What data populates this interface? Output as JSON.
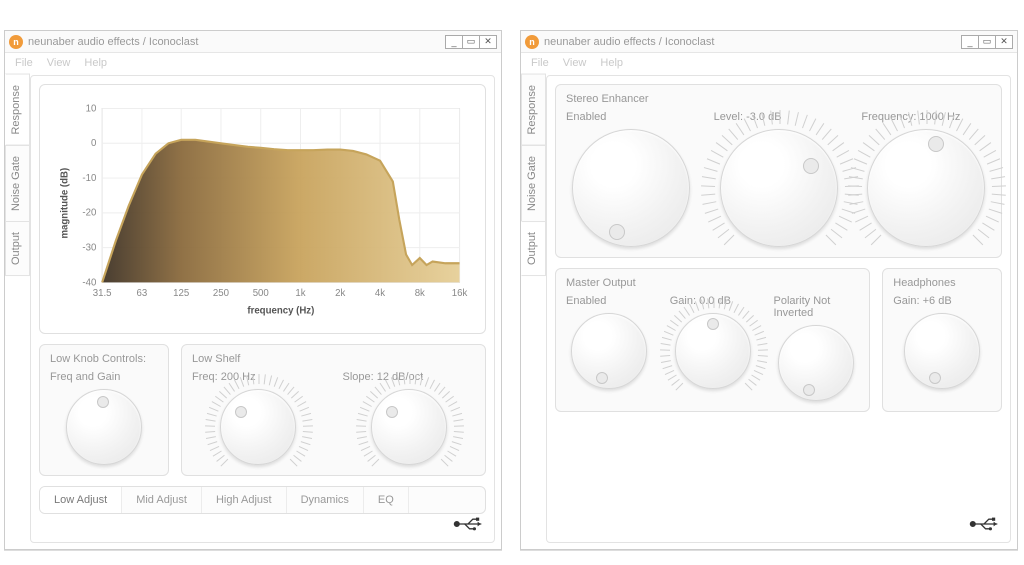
{
  "window_title": "neunaber audio effects / Iconoclast",
  "menubar": [
    "File",
    "View",
    "Help"
  ],
  "vtabs": [
    "Response",
    "Noise Gate",
    "Output"
  ],
  "vtab_selected_left": "Response",
  "vtab_selected_right": "Output",
  "left": {
    "low_controls_hdr": "Low Knob Controls:",
    "low_shelf_hdr": "Low Shelf",
    "freq_gain_lbl": "Freq and Gain",
    "low_freq_lbl": "Freq: 200 Hz",
    "low_slope_lbl": "Slope: 12 dB/oct",
    "tabs": [
      "Low Adjust",
      "Mid Adjust",
      "High Adjust",
      "Dynamics",
      "EQ"
    ],
    "tab_selected": "Low Adjust"
  },
  "right": {
    "stereo_hdr": "Stereo Enhancer",
    "stereo_enable_lbl": "Enabled",
    "stereo_level_lbl": "Level: -3.0 dB",
    "stereo_freq_lbl": "Frequency: 1000 Hz",
    "master_hdr": "Master Output",
    "headphones_hdr": "Headphones",
    "master_enable_lbl": "Enabled",
    "master_gain_lbl": "Gain: 0.0 dB",
    "polarity_lbl": "Polarity Not Inverted",
    "hp_gain_lbl": "Gain: +6 dB"
  },
  "chart_data": {
    "type": "line",
    "title": "",
    "xlabel": "frequency (Hz)",
    "ylabel": "magnitude (dB)",
    "xscale": "log",
    "xlim": [
      31.5,
      16000
    ],
    "ylim": [
      -40,
      10
    ],
    "xticks": [
      31.5,
      63,
      125,
      250,
      500,
      1000,
      2000,
      4000,
      8000,
      16000
    ],
    "xtick_labels": [
      "31.5",
      "63",
      "125",
      "250",
      "500",
      "1k",
      "2k",
      "4k",
      "8k",
      "16k"
    ],
    "yticks": [
      -40,
      -30,
      -20,
      -10,
      0,
      10
    ],
    "series": [
      {
        "name": "response",
        "points": [
          [
            31.5,
            -40
          ],
          [
            40,
            -28
          ],
          [
            50,
            -18
          ],
          [
            63,
            -9
          ],
          [
            80,
            -3
          ],
          [
            100,
            0
          ],
          [
            125,
            1
          ],
          [
            160,
            1
          ],
          [
            200,
            0.5
          ],
          [
            250,
            0
          ],
          [
            315,
            -0.5
          ],
          [
            400,
            -1
          ],
          [
            500,
            -1.3
          ],
          [
            630,
            -1.7
          ],
          [
            800,
            -2
          ],
          [
            1000,
            -2
          ],
          [
            1250,
            -2
          ],
          [
            1600,
            -1.8
          ],
          [
            2000,
            -1.8
          ],
          [
            2500,
            -2.2
          ],
          [
            3150,
            -3.2
          ],
          [
            4000,
            -5
          ],
          [
            5000,
            -11
          ],
          [
            5600,
            -22
          ],
          [
            6300,
            -32
          ],
          [
            7000,
            -35
          ],
          [
            8000,
            -33
          ],
          [
            9000,
            -35
          ],
          [
            10000,
            -34
          ],
          [
            12500,
            -34.5
          ],
          [
            16000,
            -34.5
          ]
        ]
      }
    ]
  }
}
